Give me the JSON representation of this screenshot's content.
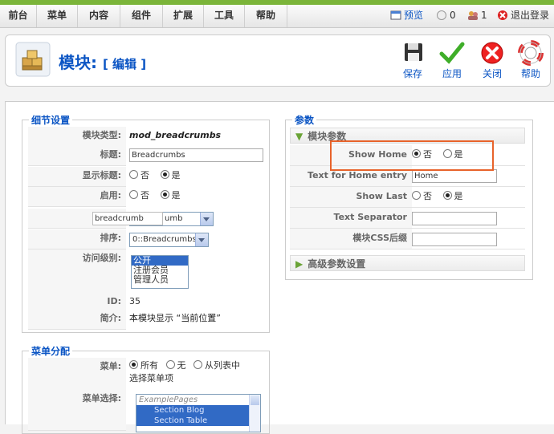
{
  "menubar": {
    "items": [
      "前台",
      "菜单",
      "内容",
      "组件",
      "扩展",
      "工具",
      "帮助"
    ],
    "preview": "预览",
    "messages": "0",
    "users": "1",
    "logout": "退出登录"
  },
  "toolbar": {
    "title": "模块:",
    "subtitle": "[ 编辑 ]",
    "save": "保存",
    "apply": "应用",
    "close": "关闭",
    "help": "帮助"
  },
  "details": {
    "legend": "细节设置",
    "type_label": "模块类型:",
    "type_value": "mod_breadcrumbs",
    "title_label": "标题:",
    "title_value": "Breadcrumbs",
    "show_title_label": "显示标题:",
    "enabled_label": "启用:",
    "no": "否",
    "yes": "是",
    "position_value": "breadcrumb",
    "position_suffix": "umb",
    "order_label": "排序:",
    "order_value": "0::Breadcrumbs",
    "access_label": "访问级别:",
    "access_options": [
      "公开",
      "注册会员",
      "管理人员"
    ],
    "id_label": "ID:",
    "id_value": "35",
    "desc_label": "简介:",
    "desc_value": "本模块显示 “当前位置”"
  },
  "menu_assign": {
    "legend": "菜单分配",
    "menus_label": "菜单:",
    "all": "所有",
    "none": "无",
    "from_list": "从列表中",
    "select_items": "选择菜单项",
    "selection_label": "菜单选择:",
    "list_items": [
      "ExamplePages",
      "Section Blog",
      "Section Table"
    ]
  },
  "params": {
    "legend": "参数",
    "module_params": "模块参数",
    "show_home_label": "Show Home",
    "home_text_label": "Text for Home entry",
    "home_text_value": "Home",
    "show_last_label": "Show Last",
    "separator_label": "Text Separator",
    "separator_value": "",
    "css_label": "模块CSS后缀",
    "css_value": "",
    "no": "否",
    "yes": "是",
    "advanced": "高级参数设置"
  }
}
